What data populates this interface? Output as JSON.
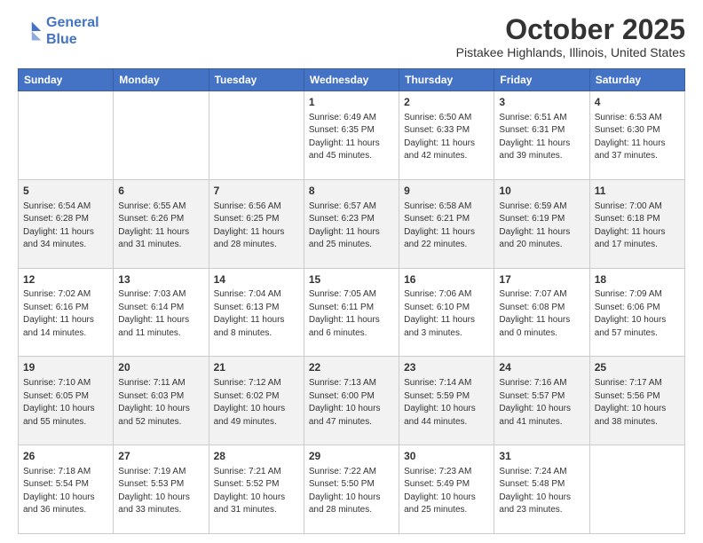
{
  "header": {
    "logo_line1": "General",
    "logo_line2": "Blue",
    "month": "October 2025",
    "location": "Pistakee Highlands, Illinois, United States"
  },
  "weekdays": [
    "Sunday",
    "Monday",
    "Tuesday",
    "Wednesday",
    "Thursday",
    "Friday",
    "Saturday"
  ],
  "weeks": [
    [
      {
        "day": "",
        "sunrise": "",
        "sunset": "",
        "daylight": ""
      },
      {
        "day": "",
        "sunrise": "",
        "sunset": "",
        "daylight": ""
      },
      {
        "day": "",
        "sunrise": "",
        "sunset": "",
        "daylight": ""
      },
      {
        "day": "1",
        "sunrise": "Sunrise: 6:49 AM",
        "sunset": "Sunset: 6:35 PM",
        "daylight": "Daylight: 11 hours and 45 minutes."
      },
      {
        "day": "2",
        "sunrise": "Sunrise: 6:50 AM",
        "sunset": "Sunset: 6:33 PM",
        "daylight": "Daylight: 11 hours and 42 minutes."
      },
      {
        "day": "3",
        "sunrise": "Sunrise: 6:51 AM",
        "sunset": "Sunset: 6:31 PM",
        "daylight": "Daylight: 11 hours and 39 minutes."
      },
      {
        "day": "4",
        "sunrise": "Sunrise: 6:53 AM",
        "sunset": "Sunset: 6:30 PM",
        "daylight": "Daylight: 11 hours and 37 minutes."
      }
    ],
    [
      {
        "day": "5",
        "sunrise": "Sunrise: 6:54 AM",
        "sunset": "Sunset: 6:28 PM",
        "daylight": "Daylight: 11 hours and 34 minutes."
      },
      {
        "day": "6",
        "sunrise": "Sunrise: 6:55 AM",
        "sunset": "Sunset: 6:26 PM",
        "daylight": "Daylight: 11 hours and 31 minutes."
      },
      {
        "day": "7",
        "sunrise": "Sunrise: 6:56 AM",
        "sunset": "Sunset: 6:25 PM",
        "daylight": "Daylight: 11 hours and 28 minutes."
      },
      {
        "day": "8",
        "sunrise": "Sunrise: 6:57 AM",
        "sunset": "Sunset: 6:23 PM",
        "daylight": "Daylight: 11 hours and 25 minutes."
      },
      {
        "day": "9",
        "sunrise": "Sunrise: 6:58 AM",
        "sunset": "Sunset: 6:21 PM",
        "daylight": "Daylight: 11 hours and 22 minutes."
      },
      {
        "day": "10",
        "sunrise": "Sunrise: 6:59 AM",
        "sunset": "Sunset: 6:19 PM",
        "daylight": "Daylight: 11 hours and 20 minutes."
      },
      {
        "day": "11",
        "sunrise": "Sunrise: 7:00 AM",
        "sunset": "Sunset: 6:18 PM",
        "daylight": "Daylight: 11 hours and 17 minutes."
      }
    ],
    [
      {
        "day": "12",
        "sunrise": "Sunrise: 7:02 AM",
        "sunset": "Sunset: 6:16 PM",
        "daylight": "Daylight: 11 hours and 14 minutes."
      },
      {
        "day": "13",
        "sunrise": "Sunrise: 7:03 AM",
        "sunset": "Sunset: 6:14 PM",
        "daylight": "Daylight: 11 hours and 11 minutes."
      },
      {
        "day": "14",
        "sunrise": "Sunrise: 7:04 AM",
        "sunset": "Sunset: 6:13 PM",
        "daylight": "Daylight: 11 hours and 8 minutes."
      },
      {
        "day": "15",
        "sunrise": "Sunrise: 7:05 AM",
        "sunset": "Sunset: 6:11 PM",
        "daylight": "Daylight: 11 hours and 6 minutes."
      },
      {
        "day": "16",
        "sunrise": "Sunrise: 7:06 AM",
        "sunset": "Sunset: 6:10 PM",
        "daylight": "Daylight: 11 hours and 3 minutes."
      },
      {
        "day": "17",
        "sunrise": "Sunrise: 7:07 AM",
        "sunset": "Sunset: 6:08 PM",
        "daylight": "Daylight: 11 hours and 0 minutes."
      },
      {
        "day": "18",
        "sunrise": "Sunrise: 7:09 AM",
        "sunset": "Sunset: 6:06 PM",
        "daylight": "Daylight: 10 hours and 57 minutes."
      }
    ],
    [
      {
        "day": "19",
        "sunrise": "Sunrise: 7:10 AM",
        "sunset": "Sunset: 6:05 PM",
        "daylight": "Daylight: 10 hours and 55 minutes."
      },
      {
        "day": "20",
        "sunrise": "Sunrise: 7:11 AM",
        "sunset": "Sunset: 6:03 PM",
        "daylight": "Daylight: 10 hours and 52 minutes."
      },
      {
        "day": "21",
        "sunrise": "Sunrise: 7:12 AM",
        "sunset": "Sunset: 6:02 PM",
        "daylight": "Daylight: 10 hours and 49 minutes."
      },
      {
        "day": "22",
        "sunrise": "Sunrise: 7:13 AM",
        "sunset": "Sunset: 6:00 PM",
        "daylight": "Daylight: 10 hours and 47 minutes."
      },
      {
        "day": "23",
        "sunrise": "Sunrise: 7:14 AM",
        "sunset": "Sunset: 5:59 PM",
        "daylight": "Daylight: 10 hours and 44 minutes."
      },
      {
        "day": "24",
        "sunrise": "Sunrise: 7:16 AM",
        "sunset": "Sunset: 5:57 PM",
        "daylight": "Daylight: 10 hours and 41 minutes."
      },
      {
        "day": "25",
        "sunrise": "Sunrise: 7:17 AM",
        "sunset": "Sunset: 5:56 PM",
        "daylight": "Daylight: 10 hours and 38 minutes."
      }
    ],
    [
      {
        "day": "26",
        "sunrise": "Sunrise: 7:18 AM",
        "sunset": "Sunset: 5:54 PM",
        "daylight": "Daylight: 10 hours and 36 minutes."
      },
      {
        "day": "27",
        "sunrise": "Sunrise: 7:19 AM",
        "sunset": "Sunset: 5:53 PM",
        "daylight": "Daylight: 10 hours and 33 minutes."
      },
      {
        "day": "28",
        "sunrise": "Sunrise: 7:21 AM",
        "sunset": "Sunset: 5:52 PM",
        "daylight": "Daylight: 10 hours and 31 minutes."
      },
      {
        "day": "29",
        "sunrise": "Sunrise: 7:22 AM",
        "sunset": "Sunset: 5:50 PM",
        "daylight": "Daylight: 10 hours and 28 minutes."
      },
      {
        "day": "30",
        "sunrise": "Sunrise: 7:23 AM",
        "sunset": "Sunset: 5:49 PM",
        "daylight": "Daylight: 10 hours and 25 minutes."
      },
      {
        "day": "31",
        "sunrise": "Sunrise: 7:24 AM",
        "sunset": "Sunset: 5:48 PM",
        "daylight": "Daylight: 10 hours and 23 minutes."
      },
      {
        "day": "",
        "sunrise": "",
        "sunset": "",
        "daylight": ""
      }
    ]
  ]
}
